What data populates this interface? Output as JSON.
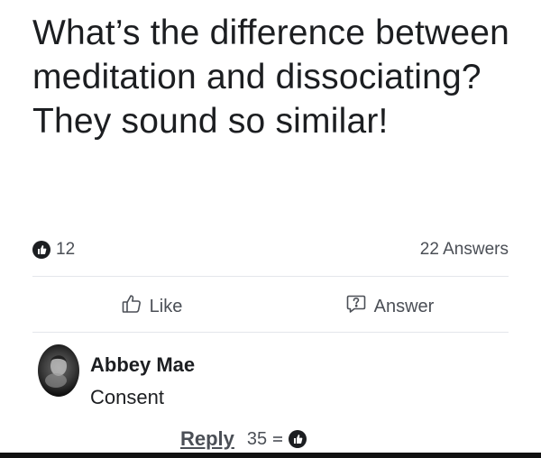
{
  "question": {
    "text": "What’s the difference between meditation and dissociating? They sound so similar!"
  },
  "stats": {
    "upvotes": "12",
    "answers": "22 Answers"
  },
  "actions": {
    "like_label": "Like",
    "answer_label": "Answer"
  },
  "comment": {
    "author": "Abbey Mae",
    "text": "Consent",
    "reply_label": "Reply",
    "votes": "35"
  },
  "icons": {
    "upvote": "upvote-icon",
    "like": "thumbs-up-icon",
    "answer": "question-bubble-icon",
    "reply_vote": "upvote-icon"
  },
  "colors": {
    "text": "#1c1e21",
    "muted": "#4b4f56",
    "divider": "#e4e6eb"
  }
}
